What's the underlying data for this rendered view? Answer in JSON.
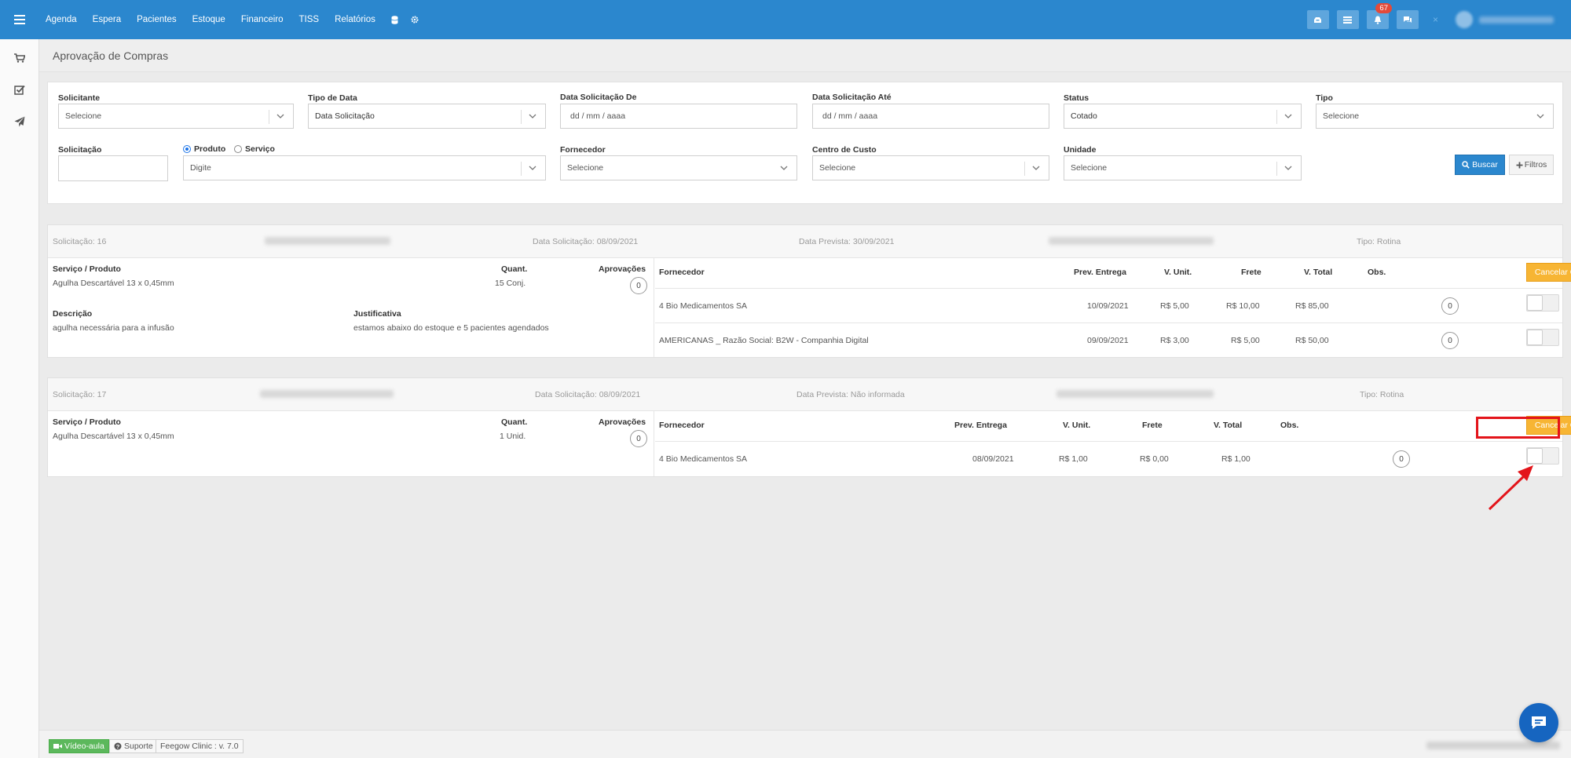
{
  "topnav": {
    "items": [
      "Agenda",
      "Espera",
      "Pacientes",
      "Estoque",
      "Financeiro",
      "TISS",
      "Relatórios"
    ],
    "notifications_count": "67",
    "close_label": "×"
  },
  "page": {
    "title": "Aprovação de Compras"
  },
  "filters": {
    "solicitante": {
      "label": "Solicitante",
      "value": "Selecione"
    },
    "tipo_data": {
      "label": "Tipo de Data",
      "value": "Data Solicitação"
    },
    "data_de": {
      "label": "Data Solicitação De",
      "placeholder": "dd / mm / aaaa"
    },
    "data_ate": {
      "label": "Data Solicitação Até",
      "placeholder": "dd / mm / aaaa"
    },
    "status": {
      "label": "Status",
      "value": "Cotado"
    },
    "tipo": {
      "label": "Tipo",
      "value": "Selecione"
    },
    "solicitacao": {
      "label": "Solicitação",
      "value": ""
    },
    "radio_produto": "Produto",
    "radio_servico": "Serviço",
    "item": {
      "placeholder": "Digite"
    },
    "fornecedor": {
      "label": "Fornecedor",
      "value": "Selecione"
    },
    "centro_custo": {
      "label": "Centro de Custo",
      "value": "Selecione"
    },
    "unidade": {
      "label": "Unidade",
      "value": "Selecione"
    },
    "buscar_label": "Buscar",
    "filtros_label": "Filtros"
  },
  "columns": {
    "servico_produto": "Serviço / Produto",
    "quant": "Quant.",
    "aprovacoes": "Aprovações",
    "descricao": "Descrição",
    "justificativa": "Justificativa",
    "fornecedor": "Fornecedor",
    "prev_entrega": "Prev. Entrega",
    "v_unit": "V. Unit.",
    "frete": "Frete",
    "v_total": "V. Total",
    "obs": "Obs.",
    "cancel_label": "Cancelar Compra"
  },
  "requests": [
    {
      "solicitacao": "Solicitação: 16",
      "data_solicitacao": "Data Solicitação: 08/09/2021",
      "data_prevista": "Data Prevista: 30/09/2021",
      "tipo": "Tipo: Rotina",
      "produto": "Agulha Descartável 13 x 0,45mm",
      "quant": "15 Conj.",
      "aprovacoes": "0",
      "descricao": "agulha necessária para a infusão",
      "justificativa": "estamos abaixo do estoque e 5 pacientes agendados",
      "quotes": [
        {
          "fornecedor": "4 Bio Medicamentos SA",
          "prev": "10/09/2021",
          "vunit": "R$ 5,00",
          "frete": "R$ 10,00",
          "vtotal": "R$ 85,00",
          "obs": "0"
        },
        {
          "fornecedor": "AMERICANAS _ Razão Social: B2W - Companhia Digital",
          "prev": "09/09/2021",
          "vunit": "R$ 3,00",
          "frete": "R$ 5,00",
          "vtotal": "R$ 50,00",
          "obs": "0"
        }
      ]
    },
    {
      "solicitacao": "Solicitação: 17",
      "data_solicitacao": "Data Solicitação: 08/09/2021",
      "data_prevista": "Data Prevista: Não informada",
      "tipo": "Tipo: Rotina",
      "produto": "Agulha Descartável 13 x 0,45mm",
      "quant": "1 Unid.",
      "aprovacoes": "0",
      "quotes": [
        {
          "fornecedor": "4 Bio Medicamentos SA",
          "prev": "08/09/2021",
          "vunit": "R$ 1,00",
          "frete": "R$ 0,00",
          "vtotal": "R$ 1,00",
          "obs": "0"
        }
      ]
    }
  ],
  "footer": {
    "video_label": "Vídeo-aula",
    "suporte_label": "Suporte",
    "version_label": "Feegow Clinic : v. 7.0"
  },
  "colors": {
    "primary": "#2b87ce",
    "cancel": "#f7b534",
    "highlight": "#e3141a",
    "video": "#5cb85c"
  }
}
